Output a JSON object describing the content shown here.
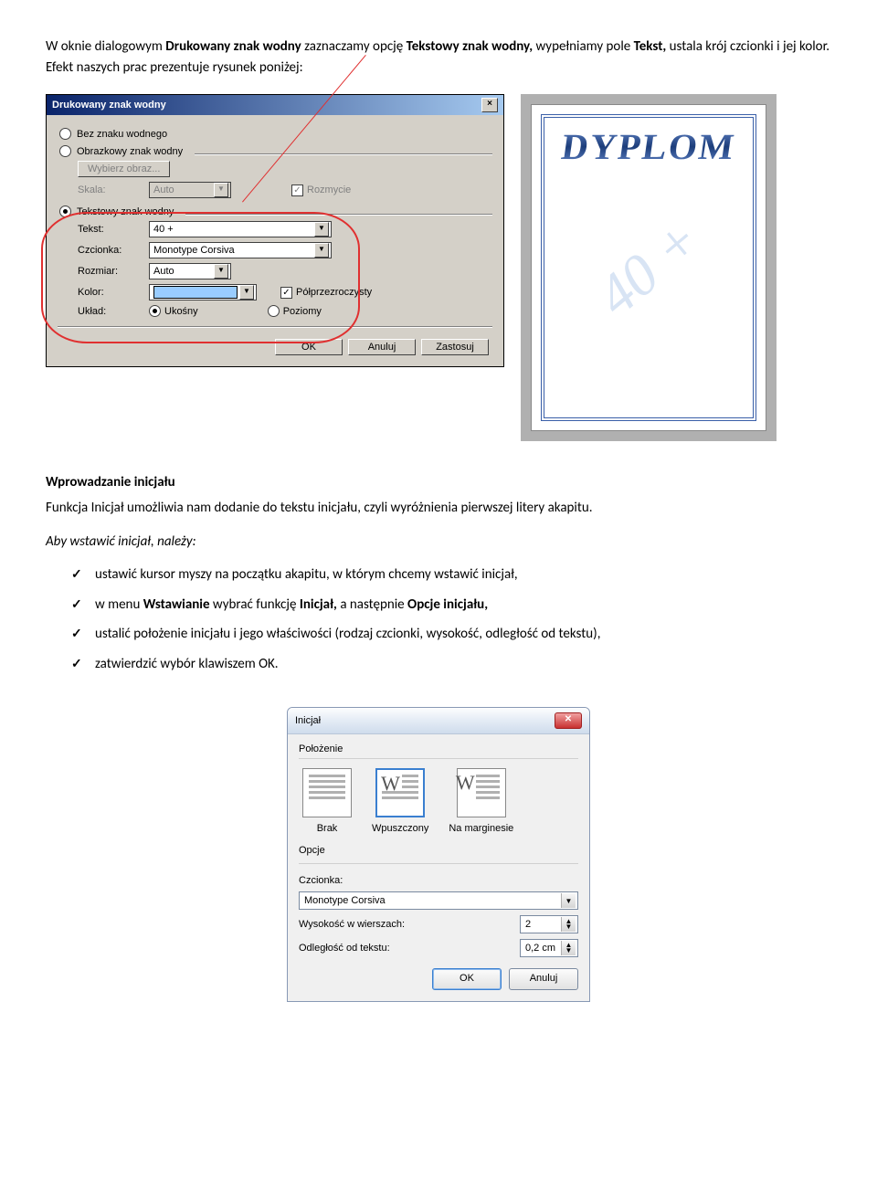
{
  "intro": {
    "part1": "W oknie dialogowym ",
    "bold1": "Drukowany znak wodny",
    "part2": " zaznaczamy opcję ",
    "bold2": "Tekstowy znak wodny,",
    "part3": " wypełniamy pole ",
    "bold3": "Tekst,",
    "part4": " ustala krój czcionki i jej kolor. Efekt naszych prac prezentuje rysunek poniżej:"
  },
  "dlg1": {
    "title": "Drukowany znak wodny",
    "close": "×",
    "opt_none": "Bez znaku wodnego",
    "opt_image": "Obrazkowy znak wodny",
    "btn_select_image": "Wybierz obraz...",
    "lbl_scale": "Skala:",
    "scale_value": "Auto",
    "chk_blur": "Rozmycie",
    "opt_text": "Tekstowy znak wodny",
    "lbl_text": "Tekst:",
    "text_value": "40 +",
    "lbl_font": "Czcionka:",
    "font_value": "Monotype Corsiva",
    "lbl_size": "Rozmiar:",
    "size_value": "Auto",
    "lbl_color": "Kolor:",
    "chk_semi": "Półprzezroczysty",
    "lbl_layout": "Układ:",
    "layout_diag": "Ukośny",
    "layout_horiz": "Poziomy",
    "btn_ok": "OK",
    "btn_cancel": "Anuluj",
    "btn_apply": "Zastosuj"
  },
  "preview": {
    "title_text": "DYPLOM",
    "watermark_text": "40 +"
  },
  "section2": {
    "heading": "Wprowadzanie inicjału",
    "para_a": "Funkcja Inicjał umożliwia nam dodanie do tekstu inicjału, czyli wyróżnienia pierwszej litery akapitu.",
    "para_b": "Aby wstawić inicjał, należy:",
    "li1": "ustawić kursor myszy na początku akapitu, w którym chcemy wstawić inicjał,",
    "li2a": "w menu ",
    "li2b": "Wstawianie",
    "li2c": " wybrać funkcję ",
    "li2d": "Inicjał,",
    "li2e": " a następnie ",
    "li2f": "Opcje inicjału,",
    "li3": "ustalić położenie inicjału i jego właściwości (rodzaj czcionki, wysokość, odległość od tekstu),",
    "li4": "zatwierdzić wybór klawiszem OK."
  },
  "dlg2": {
    "title": "Inicjał",
    "close": "✕",
    "grp_pos": "Położenie",
    "pos_none": "Brak",
    "pos_drop": "Wpuszczony",
    "pos_margin": "Na marginesie",
    "grp_opts": "Opcje",
    "lbl_font": "Czcionka:",
    "font_value": "Monotype Corsiva",
    "lbl_height": "Wysokość w wierszach:",
    "height_value": "2",
    "lbl_dist": "Odległość od tekstu:",
    "dist_value": "0,2 cm",
    "btn_ok": "OK",
    "btn_cancel": "Anuluj"
  }
}
